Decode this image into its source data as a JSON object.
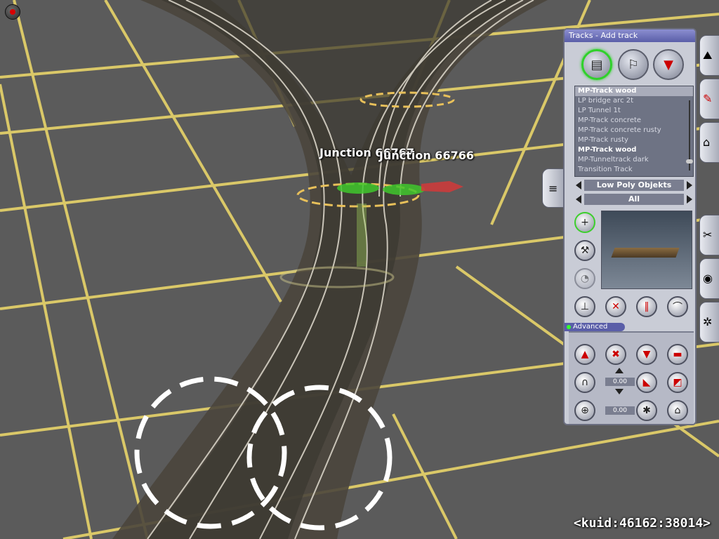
{
  "scene": {
    "junction_left": "Junction 66767",
    "junction_right": "Junction 66766",
    "kuid": "<kuid:46162:38014>"
  },
  "panel": {
    "title": "Tracks - Add track",
    "track_list": [
      "MP-Track wood",
      "LP bridge arc 2t",
      "LP Tunnel 1t",
      "MP-Track concrete",
      "MP-Track concrete rusty",
      "MP-Track rusty",
      "MP-Track wood",
      "MP-Tunneltrack dark",
      "Transition Track"
    ],
    "selected_index": 0,
    "category_filter": "Low Poly Objekts",
    "region_filter": "All",
    "advanced_label": "Advanced",
    "height_value": "0.00",
    "angle_value": "0.00"
  },
  "colors": {
    "grid_lines": "#e8d46a",
    "ground": "#5b5b5b",
    "active_outline": "#2fd12a",
    "panel_title": "#5a5ea8"
  },
  "icons": {
    "top_tools": [
      "track-tool-icon",
      "track-object-tool-icon",
      "spline-point-tool-icon"
    ],
    "side_tools": [
      "add-icon",
      "wrench-icon",
      "disabled-tool-icon"
    ],
    "track_ops": [
      "lift-icon",
      "delete-icon",
      "split-icon",
      "curve-icon"
    ],
    "side_tabs": [
      "terrain-tab-icon",
      "paint-tab-icon",
      "objects-tab-icon",
      "tools-tab-icon",
      "globe-tab-icon",
      "train-tab-icon"
    ]
  }
}
